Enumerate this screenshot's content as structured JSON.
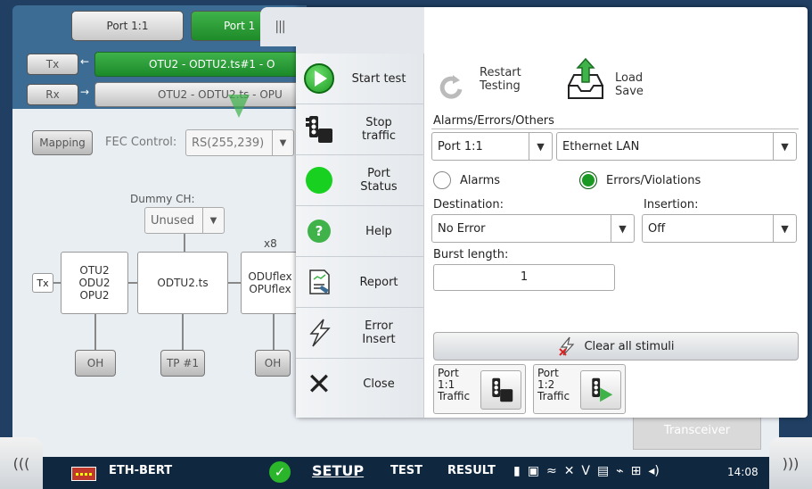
{
  "background": {
    "port_tabs": [
      "Port 1:1",
      "Port 1"
    ],
    "tx_label": "Tx",
    "rx_label": "Rx",
    "tx_signal": "OTU2 - ODTU2.ts#1 - O",
    "rx_signal": "OTU2 - ODTU2.ts - OPU",
    "mapping_label": "Mapping",
    "fec_label": "FEC Control:",
    "fec_value": "RS(255,239)",
    "dummy_label": "Dummy CH:",
    "dummy_value": "Unused",
    "x8_label": "x8",
    "tx_small": "Tx",
    "box_otu": [
      "OTU2",
      "ODU2",
      "OPU2"
    ],
    "box_odtu": "ODTU2.ts",
    "box_oduflex": [
      "ODUflex",
      "OPUflex"
    ],
    "oh1": "OH",
    "tp1": "TP #1",
    "oh2": "OH",
    "transceiver": "Transceiver",
    "handle_glyph": "|||"
  },
  "menu": {
    "items": [
      {
        "label": "Start test",
        "icon": "play-icon"
      },
      {
        "label": "Stop traffic",
        "icon": "traffic-light-stop-icon"
      },
      {
        "label": "Port Status",
        "icon": "status-dot-icon"
      },
      {
        "label": "Help",
        "icon": "help-icon"
      },
      {
        "label": "Report",
        "icon": "report-icon"
      },
      {
        "label": "Error Insert",
        "icon": "lightning-icon"
      },
      {
        "label": "Close",
        "icon": "close-icon"
      }
    ]
  },
  "content": {
    "restart": "Restart Testing",
    "load_save": "Load Save",
    "section_title": "Alarms/Errors/Others",
    "port_select": "Port 1:1",
    "layer_select": "Ethernet LAN",
    "radio_alarms": "Alarms",
    "radio_errors": "Errors/Violations",
    "destination_label": "Destination:",
    "destination_value": "No Error",
    "insertion_label": "Insertion:",
    "insertion_value": "Off",
    "burst_label": "Burst length:",
    "burst_value": "1",
    "clear_stimuli": "Clear all stimuli",
    "traffic_buttons": [
      {
        "label": "Port 1:1 Traffic"
      },
      {
        "label": "Port 1:2 Traffic"
      }
    ]
  },
  "statusbar": {
    "app_name": "ETH-BERT",
    "tabs": [
      "SETUP",
      "TEST",
      "RESULT"
    ],
    "active_tab": "SETUP",
    "clock": "14:08",
    "left_nav": "(((",
    "right_nav": ")))"
  },
  "colors": {
    "accent_green": "#3fb24a",
    "statusbar": "#0f2840"
  }
}
